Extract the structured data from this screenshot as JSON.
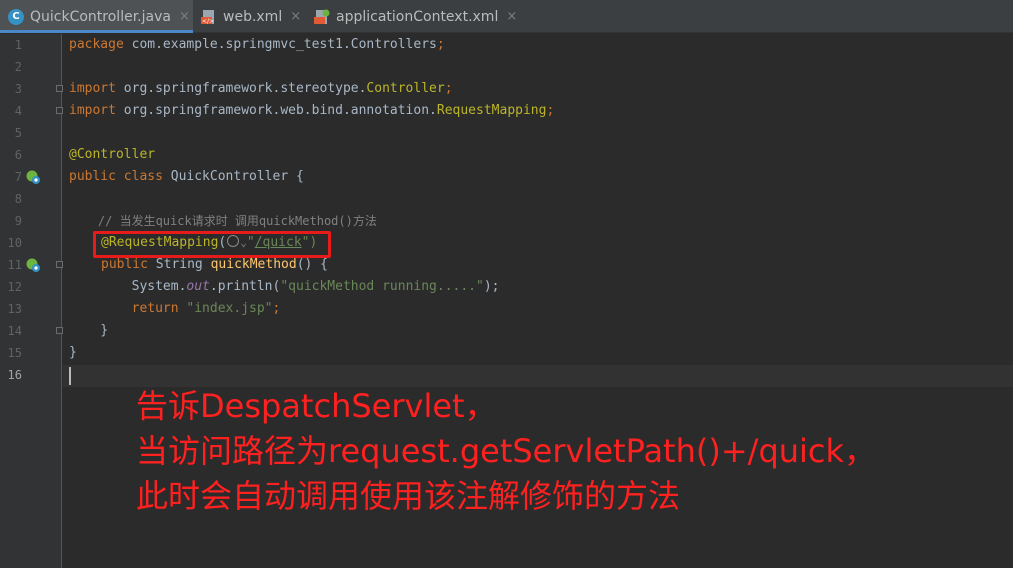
{
  "tabs": [
    {
      "label": "QuickController.java",
      "icon": "java-class-icon",
      "active": true
    },
    {
      "label": "web.xml",
      "icon": "xml-file-icon",
      "active": false
    },
    {
      "label": "applicationContext.xml",
      "icon": "xml-file-icon",
      "active": false
    }
  ],
  "tab_close_glyph": "×",
  "line_numbers": [
    "1",
    "2",
    "3",
    "4",
    "5",
    "6",
    "7",
    "8",
    "9",
    "10",
    "11",
    "12",
    "13",
    "14",
    "15",
    "16"
  ],
  "code": {
    "l1_kw": "package",
    "l1_rest": " com.example.springmvc_test1.Controllers",
    "semicolon": ";",
    "l3_kw": "import",
    "l3_pkg": " org.springframework.stereotype.",
    "l3_cls": "Controller",
    "l4_kw": "import",
    "l4_pkg": " org.springframework.web.bind.annotation.",
    "l4_cls": "RequestMapping",
    "l6_ann": "@Controller",
    "l7_kw": "public class",
    "l7_rest": " QuickController {",
    "l9_cmt": "    // 当发生quick请求时 调用quickMethod()方法",
    "l10_ann": "@RequestMapping",
    "l10_open": "(",
    "l10_dd": "⌄",
    "l10_q": "\"",
    "l10_url": "/quick",
    "l10_close": "\")",
    "l11_kw": "public",
    "l11_mid": " String ",
    "l11_fn": "quickMethod",
    "l11_end": "() {",
    "l12_a": "        System.",
    "l12_static": "out",
    "l12_b": ".println(",
    "l12_str": "\"quickMethod running.....\"",
    "l12_c": ");",
    "l13_kw": "        return",
    "l13_str": " \"index.jsp\"",
    "l14": "    }",
    "l15": "}"
  },
  "annotation_note": {
    "line1": "告诉DespatchServlet，",
    "line2": "当访问路径为request.getServletPath()+/quick，",
    "line3": "此时会自动调用使用该注解修饰的方法"
  },
  "colors": {
    "background": "#2b2b2b",
    "keyword": "#cc7832",
    "string": "#6a8759",
    "annotation": "#bbb529",
    "highlight_box": "#e81b1b",
    "note_text": "#ff2020"
  }
}
